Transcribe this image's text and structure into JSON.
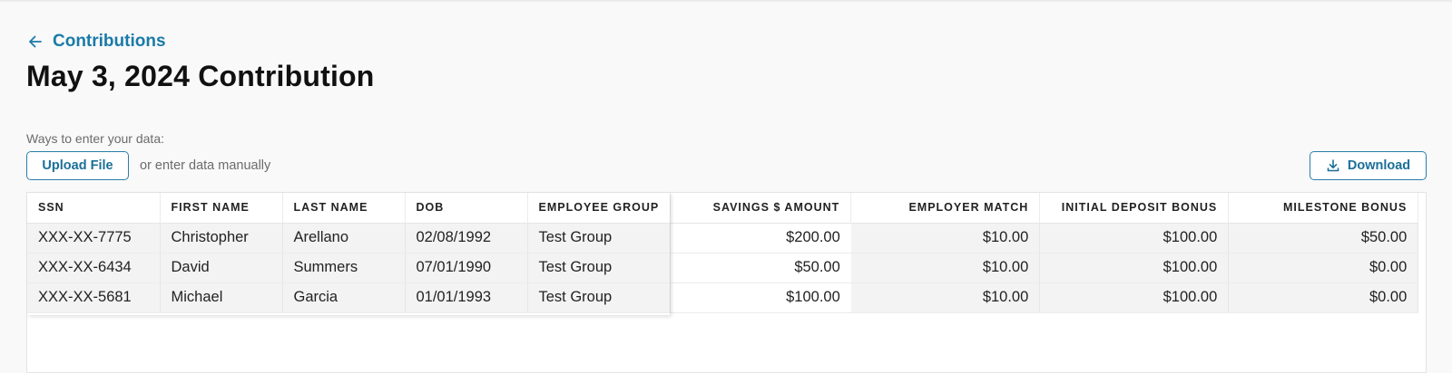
{
  "nav": {
    "back_label": "Contributions"
  },
  "page": {
    "title": "May 3, 2024 Contribution"
  },
  "entry": {
    "ways_label": "Ways to enter your data:",
    "upload_label": "Upload File",
    "manual_label": "or enter data manually",
    "download_label": "Download"
  },
  "table": {
    "headers": [
      "SSN",
      "FIRST NAME",
      "LAST NAME",
      "DOB",
      "EMPLOYEE GROUP",
      "SAVINGS $ AMOUNT",
      "EMPLOYER MATCH",
      "INITIAL DEPOSIT BONUS",
      "MILESTONE BONUS"
    ],
    "rows": [
      [
        "XXX-XX-7775",
        "Christopher",
        "Arellano",
        "02/08/1992",
        "Test Group",
        "$200.00",
        "$10.00",
        "$100.00",
        "$50.00"
      ],
      [
        "XXX-XX-6434",
        "David",
        "Summers",
        "07/01/1990",
        "Test Group",
        "$50.00",
        "$10.00",
        "$100.00",
        "$0.00"
      ],
      [
        "XXX-XX-5681",
        "Michael",
        "Garcia",
        "01/01/1993",
        "Test Group",
        "$100.00",
        "$10.00",
        "$100.00",
        "$0.00"
      ]
    ]
  },
  "colors": {
    "accent": "#1a7aa8",
    "frozen_bg": "#f3f3f3"
  },
  "icons": {
    "back": "arrow-left-icon",
    "download": "download-icon"
  }
}
